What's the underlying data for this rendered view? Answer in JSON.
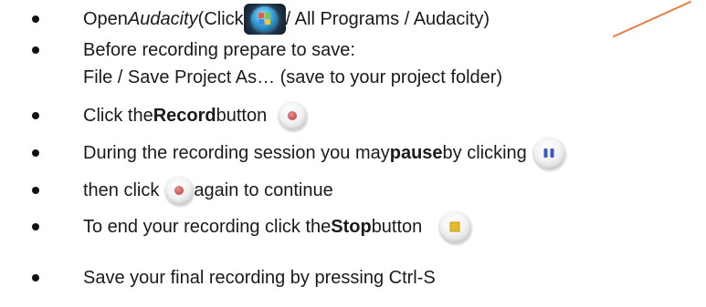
{
  "items": [
    {
      "before": "Open ",
      "italic": "Audacity",
      "mid": " (Click ",
      "icon": "windows-start-orb-icon",
      "after": " / All Programs / Audacity)"
    },
    {
      "line1": "Before recording prepare to save:",
      "line2": "File / Save Project As… (save to your project folder)"
    },
    {
      "before": "Click the ",
      "bold": "Record",
      "after": " button",
      "icon": "record-icon"
    },
    {
      "before": "During the recording session you may ",
      "bold": "pause",
      "after": " by clicking",
      "icon": "pause-icon"
    },
    {
      "before": "then click ",
      "icon": "record-icon",
      "after": " again to continue"
    },
    {
      "before": "To end your recording click the ",
      "bold": "Stop",
      "after": " button",
      "icon": "stop-icon"
    },
    {
      "text": "Save your final recording by pressing Ctrl-S"
    }
  ],
  "colors": {
    "record": "#c0504d",
    "pause": "#3a56c9",
    "stop": "#e8b82d",
    "annotation_line": "#e87a3c"
  }
}
